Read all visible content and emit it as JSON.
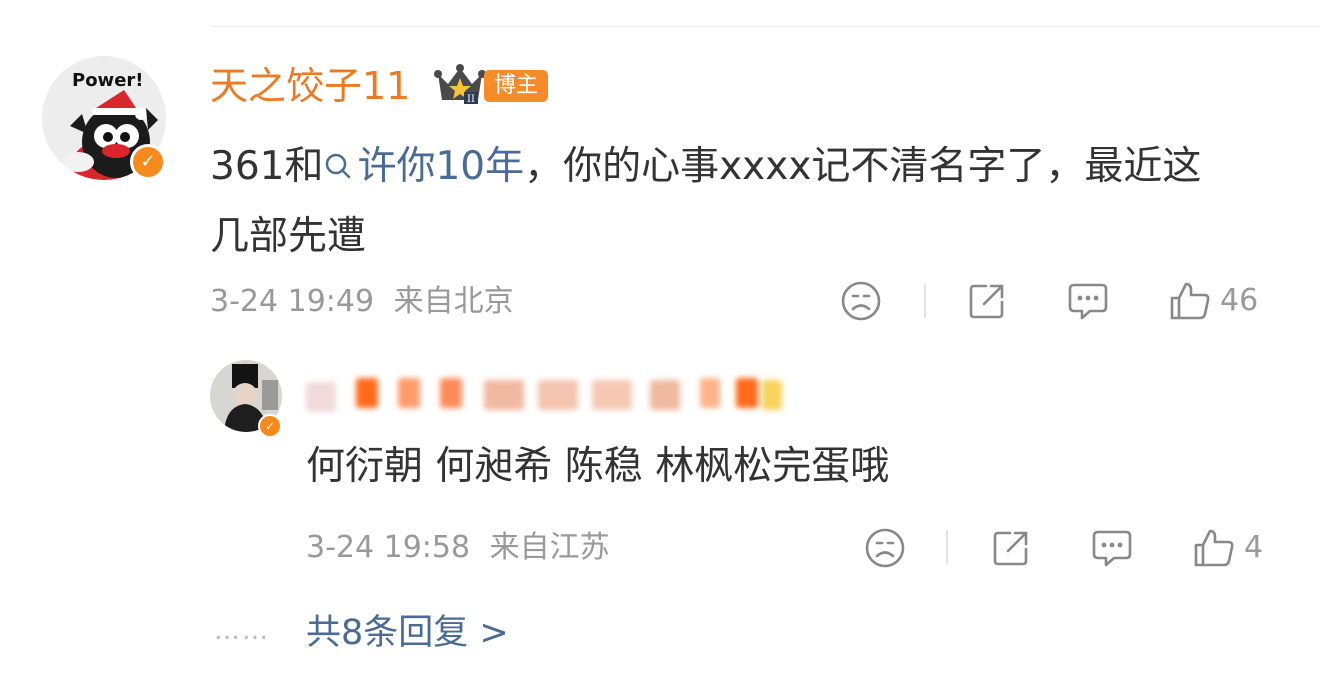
{
  "comment": {
    "avatar_caption": "Power!",
    "username": "天之饺子11",
    "badge_label": "博主",
    "text_before": "361和",
    "topic": "许你10年",
    "text_after": "，你的心事xxxx记不清名字了，最近这几部先遭",
    "date": "3-24 19:49",
    "location": "来自北京",
    "like_count": "46",
    "accent_color": "#eb7a23",
    "link_color": "#4a6b94"
  },
  "reply": {
    "text": "何衍朝 何昶希 陈稳 林枫松完蛋哦",
    "date": "3-24 19:58",
    "location": "来自江苏",
    "like_count": "4"
  },
  "more_dots": "……",
  "more_replies": "共8条回复 >",
  "icons": [
    "dislike-icon",
    "share-icon",
    "comment-icon",
    "like-icon",
    "search-icon",
    "verified-icon",
    "crown-icon"
  ]
}
